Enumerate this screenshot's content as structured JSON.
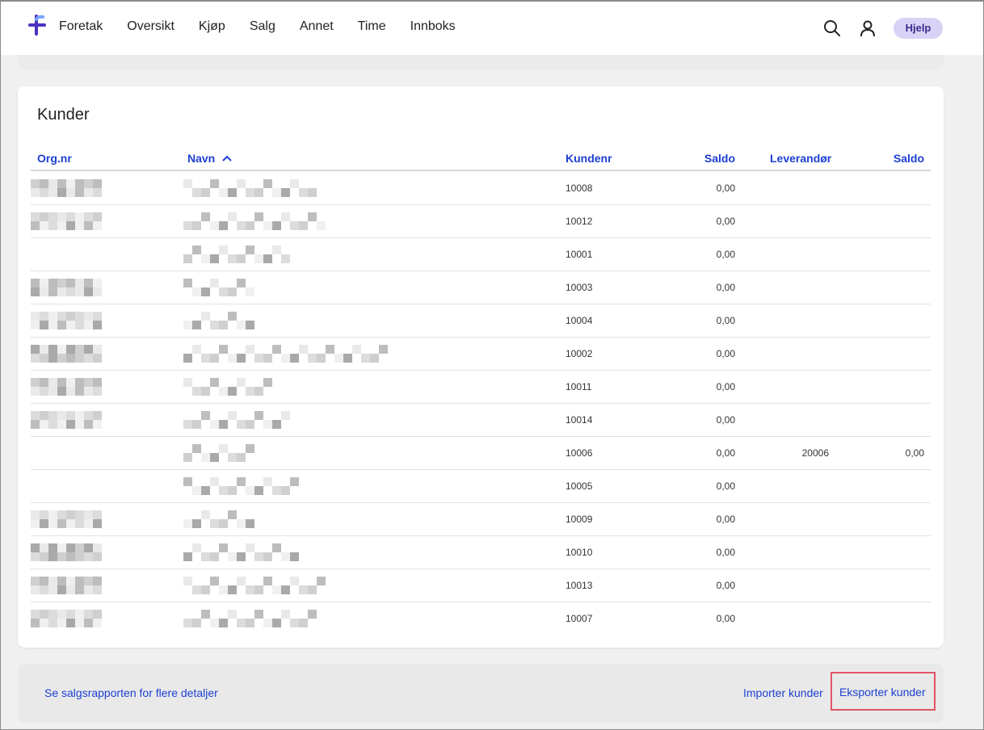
{
  "nav": {
    "items": [
      "Foretak",
      "Oversikt",
      "Kjøp",
      "Salg",
      "Annet",
      "Time",
      "Innboks"
    ],
    "help_label": "Hjelp"
  },
  "icons": {
    "search": "search-icon",
    "user": "user-icon",
    "logo": "plus-logo-icon",
    "sort": "chevron-up-icon"
  },
  "colors": {
    "link": "#1d3fd1",
    "help_bg": "#d9d2f7",
    "highlight": "#e05566"
  },
  "customers": {
    "title": "Kunder",
    "columns": {
      "orgnr": "Org.nr",
      "name": "Navn",
      "customer_no": "Kundenr",
      "balance": "Saldo",
      "supplier": "Leverandør",
      "supplier_balance": "Saldo"
    },
    "rows": [
      {
        "customer_no": "10008",
        "balance": "0,00",
        "supplier": "",
        "supplier_balance": ""
      },
      {
        "customer_no": "10012",
        "balance": "0,00",
        "supplier": "",
        "supplier_balance": ""
      },
      {
        "customer_no": "10001",
        "balance": "0,00",
        "supplier": "",
        "supplier_balance": ""
      },
      {
        "customer_no": "10003",
        "balance": "0,00",
        "supplier": "",
        "supplier_balance": ""
      },
      {
        "customer_no": "10004",
        "balance": "0,00",
        "supplier": "",
        "supplier_balance": ""
      },
      {
        "customer_no": "10002",
        "balance": "0,00",
        "supplier": "",
        "supplier_balance": ""
      },
      {
        "customer_no": "10011",
        "balance": "0,00",
        "supplier": "",
        "supplier_balance": ""
      },
      {
        "customer_no": "10014",
        "balance": "0,00",
        "supplier": "",
        "supplier_balance": ""
      },
      {
        "customer_no": "10006",
        "balance": "0,00",
        "supplier": "20006",
        "supplier_balance": "0,00"
      },
      {
        "customer_no": "10005",
        "balance": "0,00",
        "supplier": "",
        "supplier_balance": ""
      },
      {
        "customer_no": "10009",
        "balance": "0,00",
        "supplier": "",
        "supplier_balance": ""
      },
      {
        "customer_no": "10010",
        "balance": "0,00",
        "supplier": "",
        "supplier_balance": ""
      },
      {
        "customer_no": "10013",
        "balance": "0,00",
        "supplier": "",
        "supplier_balance": ""
      },
      {
        "customer_no": "10007",
        "balance": "0,00",
        "supplier": "",
        "supplier_balance": ""
      }
    ]
  },
  "footer": {
    "report_link": "Se salgsrapporten for flere detaljer",
    "import_link": "Importer kunder",
    "export_link": "Eksporter kunder"
  }
}
